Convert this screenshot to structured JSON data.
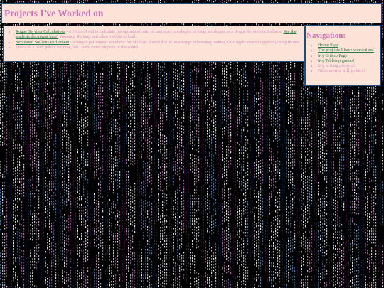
{
  "header": {
    "title": "Projects I've Worked on"
  },
  "projects": [
    {
      "link": "Rogue Servitor Calculations",
      "text": " - a Project I did to calculate the optimized ratio of sanctuary arcologies to forge arcologies as a Rogue Servitor in Stellaris. ",
      "link2": "See the analysis document here!",
      "text2": " Warning, it's long and takes a while to load."
    },
    {
      "link": "Simulated Stellaris Parliament",
      "text": " - a simple parliament simulator for Stellaris. I used this as an attempt at learning making GUI applications in python) using tkinter."
    },
    {
      "text": "That's all I have public for now, but I have more projects in the works!"
    }
  ],
  "nav": {
    "title": "Navigation:",
    "items": [
      {
        "label": "Home Page",
        "link": true
      },
      {
        "label": "The projects I have worked on!",
        "link": true
      },
      {
        "label": "My Github Page",
        "link": true
      },
      {
        "label": "My Tabletop games!",
        "link": true
      },
      {
        "label": "My writing projects!",
        "link": false
      },
      {
        "label": "Other entries will go here!",
        "link": false
      }
    ]
  },
  "colors": {
    "background": "#000000",
    "panel": "#fde2d8",
    "border": "#1f4f79",
    "heading": "#c774b3",
    "text": "#d18fc0",
    "link": "#2d7d46",
    "rain_white": "#e8e8f0",
    "rain_pink": "#cf5fc9",
    "rain_blue": "#3f7fd0"
  }
}
